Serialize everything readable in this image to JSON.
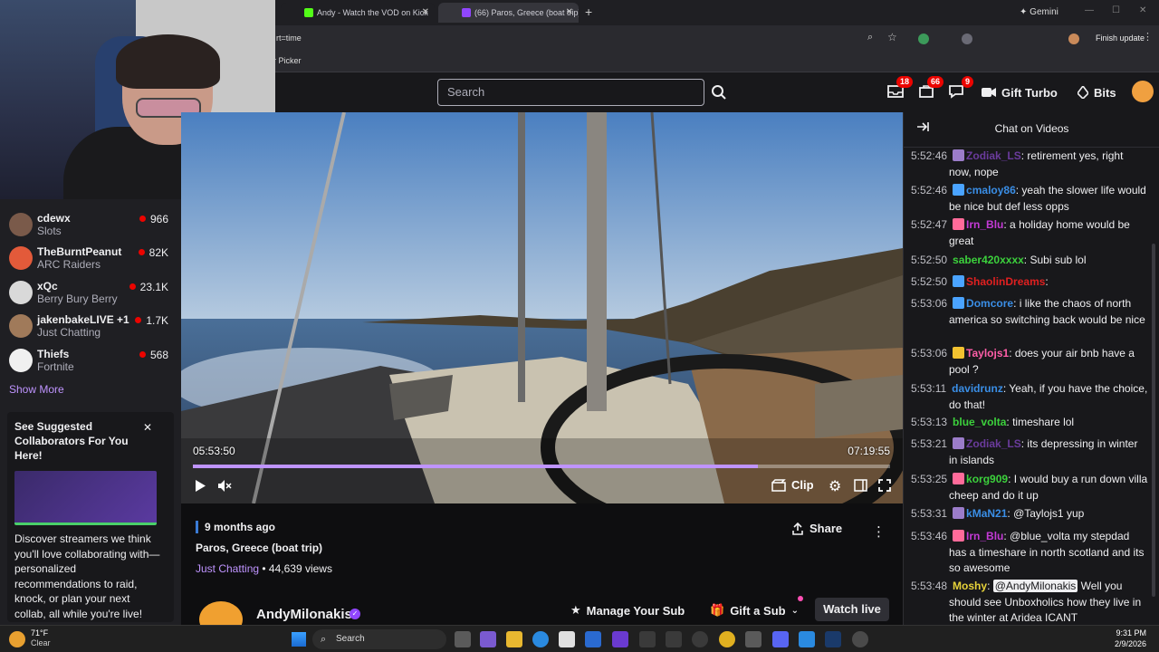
{
  "browser": {
    "tabs": [
      {
        "title": "Andy - Watch the VOD on Kick"
      },
      {
        "title": "(66) Paros, Greece (boat trip) -"
      }
    ],
    "gemini_label": "Gemini",
    "address_fragment": "rt=time",
    "bookmark": "r Picker",
    "finish_update": "Finish update"
  },
  "topnav": {
    "search_placeholder": "Search",
    "badges": {
      "inbox": "18",
      "notifications": "66",
      "whispers": "9"
    },
    "gift_turbo": "Gift Turbo",
    "bits": "Bits"
  },
  "sidebar": {
    "channels": [
      {
        "name": "cdewx",
        "game": "Slots",
        "viewers": "966",
        "avatar_color": "#7a5a4a"
      },
      {
        "name": "TheBurntPeanut",
        "game": "ARC Raiders",
        "viewers": "82K",
        "avatar_color": "#e35a3a"
      },
      {
        "name": "xQc",
        "game": "Berry Bury Berry",
        "viewers": "23.1K",
        "avatar_color": "#d9d9d9"
      },
      {
        "name": "jakenbakeLIVE +1",
        "game": "Just Chatting",
        "viewers": "1.7K",
        "avatar_color": "#a07a5a"
      },
      {
        "name": "Thiefs",
        "game": "Fortnite",
        "viewers": "568",
        "avatar_color": "#f0f0f0"
      }
    ],
    "show_more": "Show More",
    "suggest": {
      "title": "See Suggested Collaborators For You Here!",
      "body": "Discover streamers we think you'll love collaborating with—personalized recommendations to raid, knock, or plan your next collab, all while you're live!"
    }
  },
  "player": {
    "current_time": "05:53:50",
    "duration": "07:19:55",
    "progress": 0.81,
    "clip": "Clip"
  },
  "vod": {
    "age": "9 months ago",
    "title": "Paros, Greece (boat trip)",
    "category": "Just Chatting",
    "views": " • 44,639 views",
    "share": "Share",
    "channel": "AndyMilonakis",
    "manage_sub": "Manage Your Sub",
    "gift_sub": "Gift a Sub",
    "watch_live": "Watch live"
  },
  "chat": {
    "header": "Chat on Videos",
    "messages": [
      {
        "ts": "5:52:46",
        "user": "Zodiak_LS",
        "color": "#6a3b9c",
        "text": ": retirement yes, right now, nope",
        "badge": "#9b7cc9"
      },
      {
        "ts": "5:52:46",
        "user": "cmaloy86",
        "color": "#3a8ee6",
        "text": ": yeah the slower life would be nice but def less opps",
        "badge": "#4aa3ff"
      },
      {
        "ts": "5:52:47",
        "user": "Irn_Blu",
        "color": "#c43ad6",
        "text": ": a holiday home would be great",
        "badge": "#ff6b9a"
      },
      {
        "ts": "5:52:50",
        "user": "saber420xxxx",
        "color": "#3cd13c",
        "text": ": Subi sub lol",
        "badge": ""
      },
      {
        "ts": "5:52:50",
        "user": "ShaolinDreams",
        "color": "#e02020",
        "text": ":",
        "badge": "#4aa3ff"
      },
      {
        "ts": "5:53:06",
        "user": "Domcore",
        "color": "#3a8ee6",
        "text": ": i like the chaos of north america so switching back would be nice",
        "badge": "#4aa3ff"
      },
      {
        "ts": "5:53:06",
        "user": "Taylojs1",
        "color": "#ff5ea8",
        "text": ": does your air bnb have a pool ?",
        "badge": "#f2c230"
      },
      {
        "ts": "5:53:11",
        "user": "davidrunz",
        "color": "#3a8ee6",
        "text": ": Yeah, if you have the choice, do that!",
        "badge": ""
      },
      {
        "ts": "5:53:13",
        "user": "blue_volta",
        "color": "#3cd13c",
        "text": ": timeshare lol",
        "badge": ""
      },
      {
        "ts": "5:53:21",
        "user": "Zodiak_LS",
        "color": "#6a3b9c",
        "text": ": its depressing in winter in islands",
        "badge": "#9b7cc9"
      },
      {
        "ts": "5:53:25",
        "user": "korg909",
        "color": "#3cd13c",
        "text": ": I would buy a run down villa cheep and do it up",
        "badge": "#ff6b9a"
      },
      {
        "ts": "5:53:31",
        "user": "kMaN21",
        "color": "#3a8ee6",
        "text": ": @Taylojs1 yup",
        "badge": "#9b7cc9"
      },
      {
        "ts": "5:53:46",
        "user": "Irn_Blu",
        "color": "#c43ad6",
        "text": ": @blue_volta my stepdad has a timeshare in north scotland and its so awesome",
        "badge": "#ff6b9a"
      },
      {
        "ts": "5:53:48",
        "user": "Moshy",
        "color": "#e6d23a",
        "text": ": ",
        "mention": "@AndyMilonakis",
        "tail": " Well you should see Unboxholics how they live in the winter at Aridea ICANT",
        "badge": ""
      }
    ]
  },
  "taskbar": {
    "weather_temp": "71°F",
    "weather_desc": "Clear",
    "search": "Search",
    "time": "9:31 PM",
    "date": "2/9/2026"
  }
}
